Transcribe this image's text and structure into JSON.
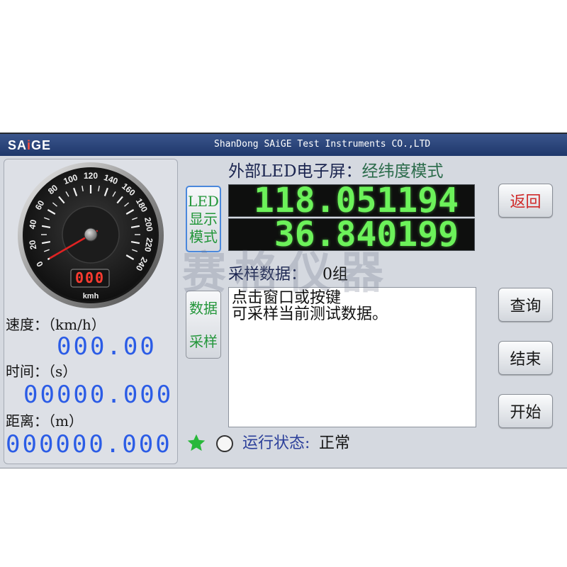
{
  "header": {
    "logo": {
      "left": "SA",
      "mid": "i",
      "right": "GE"
    },
    "company": "ShanDong SAiGE Test Instruments CO.,LTD"
  },
  "gauge": {
    "min": 0,
    "max": 240,
    "value": 0,
    "labels": [
      "0",
      "20",
      "40",
      "60",
      "80",
      "100",
      "120",
      "140",
      "160",
      "180",
      "200",
      "220",
      "240"
    ],
    "digital": "000",
    "unit": "kmh"
  },
  "readouts": {
    "speed": {
      "label": "速度：（km/h）",
      "value": "000.00"
    },
    "time": {
      "label": "时间：（s）",
      "value": "00000.000"
    },
    "distance": {
      "label": "距离：（m）",
      "value": "000000.000"
    }
  },
  "led": {
    "title_prefix": "外部LED电子屏：",
    "title_mode": "经纬度模式",
    "mode_button": [
      "LED",
      "显示",
      "模式"
    ],
    "row1": "118.051194",
    "row2": "36.840199"
  },
  "sampling": {
    "label": "采样数据：",
    "count": "0组",
    "button": [
      "数据",
      "采样"
    ],
    "message": [
      "点击窗口或按键",
      "可采样当前测试数据。"
    ]
  },
  "buttons": {
    "back": "返回",
    "query": "查询",
    "stop": "结束",
    "start": "开始"
  },
  "status": {
    "indicator_icon": "star-icon",
    "radio_icon": "radio-circle-icon",
    "label": "运行状态:",
    "value": "正常"
  },
  "watermark": "赛格仪器",
  "colors": {
    "header_bar": "#24427f",
    "screen_bg": "#d5d9e0",
    "led_digits": "#6cf25a",
    "readout_blue": "#2b5ce6",
    "back_text": "#d02a2a",
    "button_text_green": "#23963a",
    "title_mode": "#2a6b4a",
    "status_label": "#2b3f9a",
    "star": "#28b83a",
    "gauge_needle": "#e02222",
    "gauge_digital": "#ff3b30"
  }
}
